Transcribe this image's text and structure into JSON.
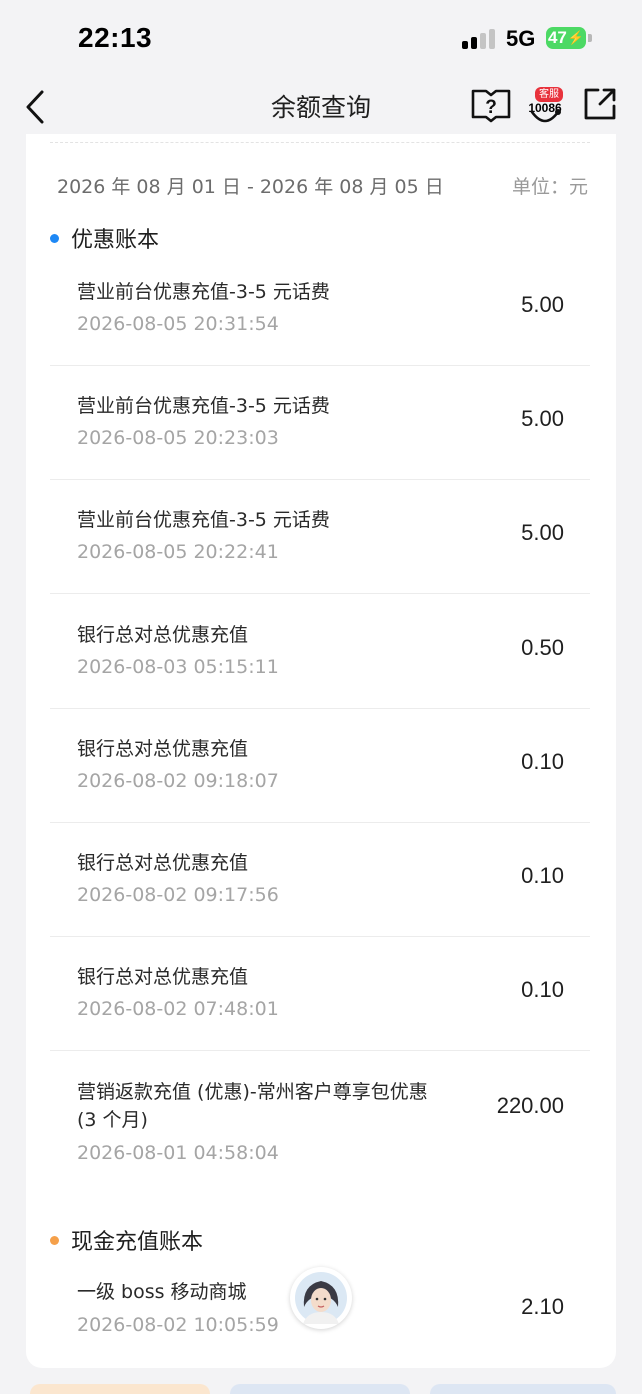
{
  "status_bar": {
    "time": "22:13",
    "network": "5G",
    "battery": "47"
  },
  "header": {
    "title": "余额查询",
    "help_icon": "question-book-icon",
    "service_badge": "客服",
    "service_number": "10086",
    "share_icon": "share-icon"
  },
  "summary": {
    "date_range": "2026 年 08 月 01 日 - 2026 年 08 月 05 日",
    "unit": "单位：元"
  },
  "colors": {
    "discount_dot": "#1e88f5",
    "cash_dot": "#f5a04a",
    "battery": "#4cd964",
    "service_badge": "#e8323c"
  },
  "discount_section": {
    "title": "优惠账本",
    "records": [
      {
        "name": "营业前台优惠充值-3-5 元话费",
        "time": "2026-08-05 20:31:54",
        "amount": "5.00"
      },
      {
        "name": "营业前台优惠充值-3-5 元话费",
        "time": "2026-08-05 20:23:03",
        "amount": "5.00"
      },
      {
        "name": "营业前台优惠充值-3-5 元话费",
        "time": "2026-08-05 20:22:41",
        "amount": "5.00"
      },
      {
        "name": "银行总对总优惠充值",
        "time": "2026-08-03 05:15:11",
        "amount": "0.50"
      },
      {
        "name": "银行总对总优惠充值",
        "time": "2026-08-02 09:18:07",
        "amount": "0.10"
      },
      {
        "name": "银行总对总优惠充值",
        "time": "2026-08-02 09:17:56",
        "amount": "0.10"
      },
      {
        "name": "银行总对总优惠充值",
        "time": "2026-08-02 07:48:01",
        "amount": "0.10"
      },
      {
        "name": "营销返款充值 (优惠)-常州客户尊享包优惠 (3 个月)",
        "time": "2026-08-01 04:58:04",
        "amount": "220.00"
      }
    ]
  },
  "cash_section": {
    "title": "现金充值账本",
    "records": [
      {
        "name": "一级 boss 移动商城",
        "time": "2026-08-02 10:05:59",
        "amount": "2.10"
      }
    ]
  },
  "assistant": {
    "icon": "assistant-avatar-icon"
  }
}
